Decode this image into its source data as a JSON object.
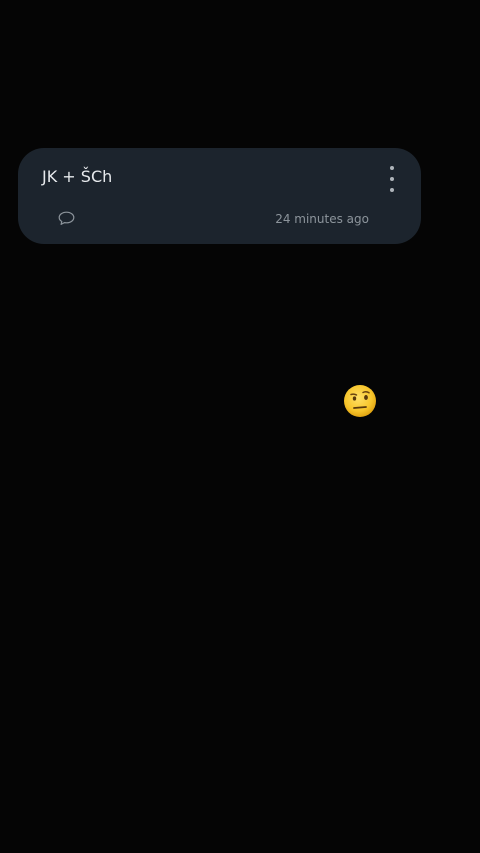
{
  "note": {
    "title": "JK + ŠCh",
    "timestamp": "24 minutes ago",
    "comment_icon": "speech-bubble-icon",
    "menu_icon": "more-vertical-icon"
  },
  "floating_emoji": {
    "icon": "face-with-raised-eyebrow"
  },
  "colors": {
    "background": "#050505",
    "card": "#1c242d",
    "title_text": "#e6e9ec",
    "meta_text": "#8c949b"
  }
}
